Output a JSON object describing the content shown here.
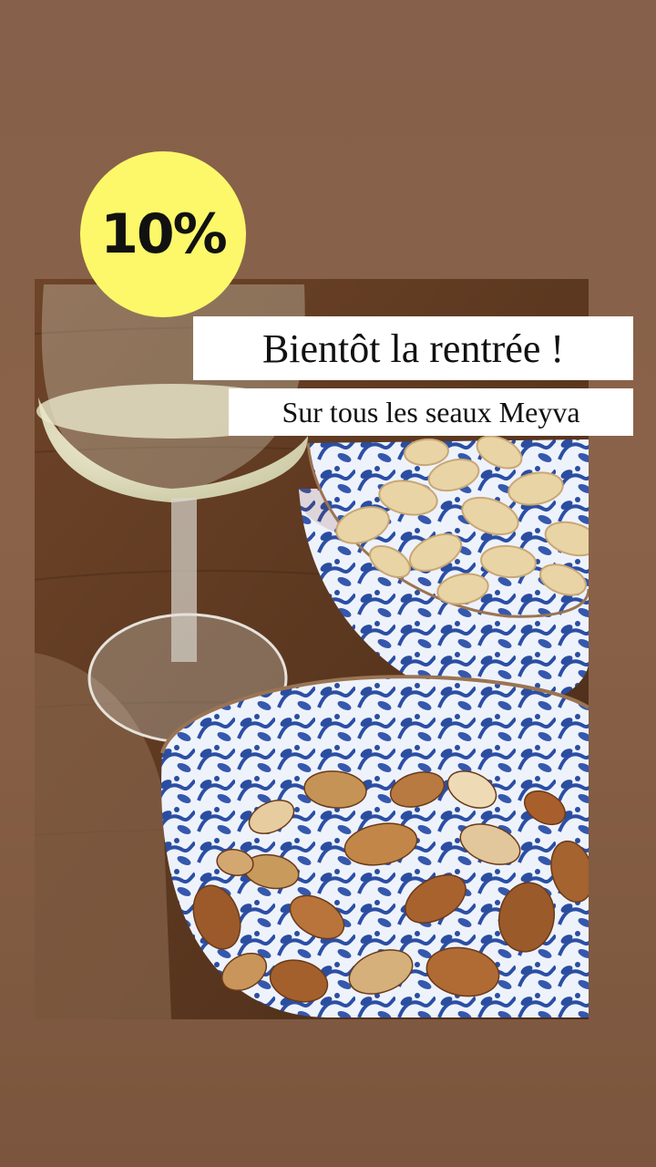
{
  "badge": {
    "text": "10%",
    "color": "#fcf86a"
  },
  "headline": "Bientôt la rentrée !",
  "subheadline": "Sur tous les seaux Meyva",
  "photo": {
    "subject": "wine-glass-and-bowls-of-mixed-nuts"
  }
}
